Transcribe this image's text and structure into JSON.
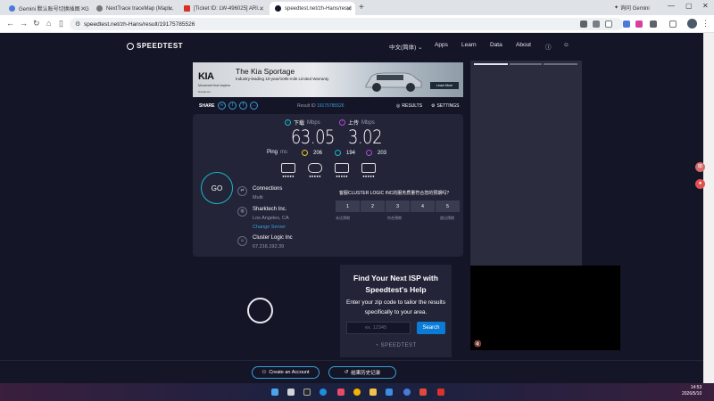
{
  "browser": {
    "tabs": [
      {
        "title": "Gemini 默认账号切换插图 - G"
      },
      {
        "title": "NextTrace traceMap (Mapl..."
      },
      {
        "title": "[Ticket ID: LW-496025] ARI..."
      },
      {
        "title": "speedtest.net/zh-Hans/resul"
      }
    ],
    "gemini_label": "询问 Gemini",
    "url": "speedtest.net/zh-Hans/result/19175785526"
  },
  "header": {
    "logo": "SPEEDTEST",
    "language": "中文(简体)",
    "nav": [
      "Apps",
      "Learn",
      "Data",
      "About"
    ]
  },
  "ad": {
    "brand": "KIA",
    "brand_tagline": "Movement that inspires",
    "headline": "The Kia Sportage",
    "subline": "Industry-leading 10-year/100k-mile Limited Warranty",
    "disclaimer": "Disclaimer",
    "cta": "Learn More"
  },
  "share_row": {
    "share_label": "SHARE",
    "result_id_label": "Result ID",
    "result_id": "19175785526",
    "results_label": "RESULTS",
    "settings_label": "SETTINGS"
  },
  "result": {
    "download_label": "下载",
    "download_unit": "Mbps",
    "download_value": "63.05",
    "upload_label": "上传",
    "upload_unit": "Mbps",
    "upload_value": "3.02",
    "ping_label": "Ping",
    "ping_unit": "ms",
    "ping_idle": "206",
    "ping_download": "194",
    "ping_upload": "203",
    "go_label": "GO",
    "connections_title": "Connections",
    "connections_value": "Multi",
    "server_name": "Sharktech Inc.",
    "server_location": "Los Angeles, CA",
    "change_server": "Change Server",
    "isp_name": "Cluster Logic Inc",
    "isp_ip": "67.216.192.39",
    "survey_question": "客服CLUSTER LOGIC INC的服务质量符合您的预期吗?",
    "ratings": [
      "1",
      "2",
      "3",
      "4",
      "5"
    ],
    "rating_low": "未达预期",
    "rating_mid": "符合预期",
    "rating_high": "超出预期"
  },
  "isp_promo": {
    "title": "Find Your Next ISP with Speedtest's Help",
    "body": "Enter your zip code to tailor the results specifically to your area.",
    "zip_placeholder": "ex. 12345",
    "search_label": "Search",
    "logo": "SPEEDTEST"
  },
  "bottom": {
    "create_account": "Create an Account",
    "history": "结果历史记录"
  },
  "taskbar": {
    "time": "14:53",
    "date": "2026/5/10"
  }
}
